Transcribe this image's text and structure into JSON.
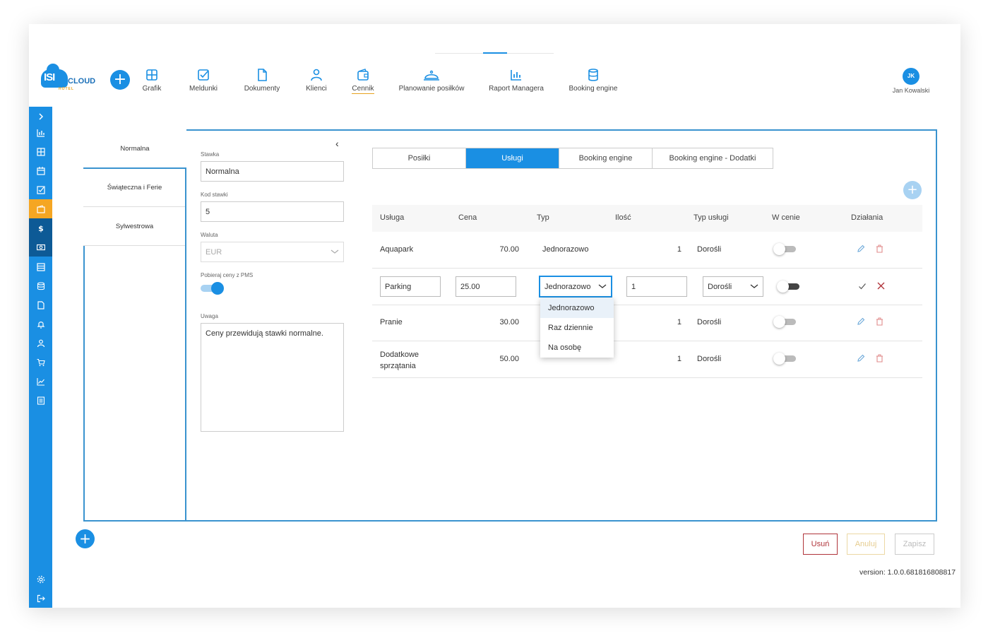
{
  "app": {
    "logo_main": "ISI",
    "logo_sub": "CLOUD",
    "logo_hotel": "HOTEL"
  },
  "nav": {
    "add": "+",
    "items": [
      {
        "label": "Grafik",
        "icon": "grid-icon"
      },
      {
        "label": "Meldunki",
        "icon": "checkbox-icon"
      },
      {
        "label": "Dokumenty",
        "icon": "document-icon"
      },
      {
        "label": "Klienci",
        "icon": "person-icon"
      },
      {
        "label": "Cennik",
        "icon": "wallet-icon",
        "active": true
      },
      {
        "label": "Planowanie posiłków",
        "icon": "cloche-icon"
      },
      {
        "label": "Raport Managera",
        "icon": "report-icon"
      },
      {
        "label": "Booking engine",
        "icon": "database-icon"
      }
    ]
  },
  "user": {
    "initials": "JK",
    "name": "Jan Kowalski"
  },
  "sidebar": {
    "items": [
      "chevron-right-icon",
      "bar-chart-icon",
      "grid-icon",
      "calendar-icon",
      "checkbox-icon",
      "wallet-icon",
      "dollar-icon",
      "cash-icon",
      "list-icon",
      "database-icon",
      "document-icon",
      "bell-icon",
      "person-icon",
      "cart-icon",
      "trend-icon",
      "notes-icon"
    ],
    "bottom": [
      "settings-icon",
      "logout-icon"
    ]
  },
  "rates": {
    "tabs": [
      "Normalna",
      "Świąteczna i Ferie",
      "Sylwestrowa"
    ]
  },
  "form": {
    "stawka_label": "Stawka",
    "stawka_value": "Normalna",
    "kod_label": "Kod stawki",
    "kod_value": "5",
    "waluta_label": "Waluta",
    "waluta_value": "EUR",
    "pms_label": "Pobieraj ceny z PMS",
    "pms_on": true,
    "uwaga_label": "Uwaga",
    "uwaga_value": "Ceny przewidują stawki normalne.",
    "collapse": "‹"
  },
  "tabs": [
    "Posiłki",
    "Usługi",
    "Booking engine",
    "Booking engine - Dodatki"
  ],
  "active_tab": "Usługi",
  "table": {
    "add": "+",
    "headers": [
      "Usługa",
      "Cena",
      "Typ",
      "Ilość",
      "Typ usługi",
      "W cenie",
      "Działania"
    ],
    "rows": [
      {
        "usluga": "Aquapark",
        "cena": "70.00",
        "typ": "Jednorazowo",
        "ilosc": "1",
        "typ_uslugi": "Dorośli",
        "w_cenie": false
      },
      {
        "usluga": "Pranie",
        "cena": "30.00",
        "typ": "",
        "ilosc": "1",
        "typ_uslugi": "Dorośli",
        "w_cenie": false
      },
      {
        "usluga": "Dodatkowe sprzątania",
        "usluga_line1": "Dodatkowe",
        "usluga_line2": "sprzątania",
        "cena": "50.00",
        "typ": "",
        "ilosc": "1",
        "typ_uslugi": "Dorośli",
        "w_cenie": false
      }
    ],
    "edit_row": {
      "usluga": "Parking",
      "cena": "25.00",
      "typ": "Jednorazowo",
      "ilosc": "1",
      "typ_uslugi": "Dorośli",
      "w_cenie": false
    }
  },
  "dropdown": {
    "options": [
      "Jednorazowo",
      "Raz dziennie",
      "Na osobę"
    ],
    "selected": "Jednorazowo"
  },
  "fab": "+",
  "buttons": {
    "delete": "Usuń",
    "cancel": "Anuluj",
    "save": "Zapisz"
  },
  "version": "version: 1.0.0.681816808817",
  "colors": {
    "primary": "#1a8fe3",
    "accent": "#f5a623",
    "danger": "#b0343a"
  }
}
